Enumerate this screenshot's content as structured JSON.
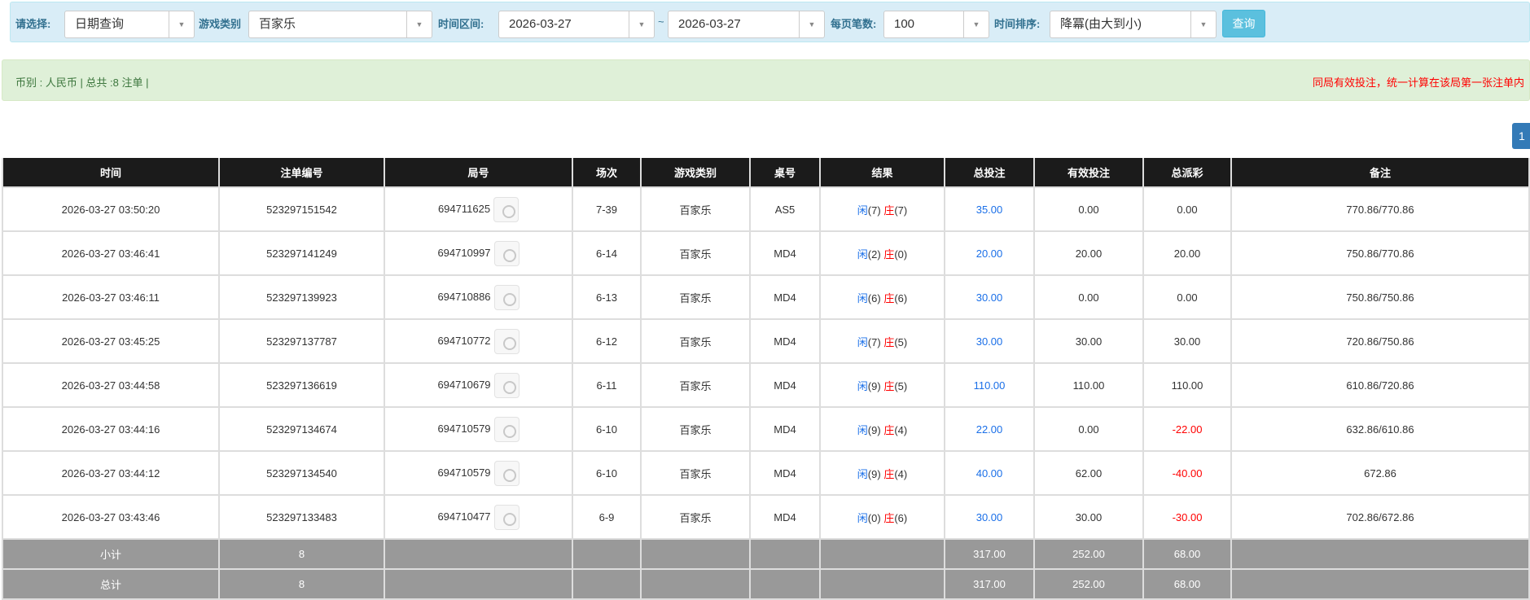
{
  "filter": {
    "select_label": "请选择:",
    "query_type": "日期查询",
    "game_label": "游戏类别",
    "game": "百家乐",
    "time_label": "时间区间:",
    "date_from": "2026-03-27",
    "tilde": "~",
    "date_to": "2026-03-27",
    "per_page_label": "每页笔数:",
    "per_page": "100",
    "sort_label": "时间排序:",
    "sort": "降冪(由大到小)",
    "search_button": "查询"
  },
  "info": {
    "summary": "币别 : 人民币 | 总共 :8 注单 |",
    "notice": "同局有效投注，统一计算在该局第一张注单内"
  },
  "pagination": {
    "current": "1"
  },
  "table": {
    "headers": [
      "时间",
      "注单编号",
      "局号",
      "场次",
      "游戏类别",
      "桌号",
      "结果",
      "总投注",
      "有效投注",
      "总派彩",
      "备注"
    ],
    "rows": [
      {
        "time": "2026-03-27 03:50:20",
        "order": "523297151542",
        "round": "694711625",
        "session": "7-39",
        "game": "百家乐",
        "table": "AS5",
        "player": "闲",
        "pv": "(7)",
        "banker": "庄",
        "bv": "(7)",
        "bet": "35.00",
        "valid": "0.00",
        "payout": "0.00",
        "payout_neg": false,
        "note": "770.86/770.86"
      },
      {
        "time": "2026-03-27 03:46:41",
        "order": "523297141249",
        "round": "694710997",
        "session": "6-14",
        "game": "百家乐",
        "table": "MD4",
        "player": "闲",
        "pv": "(2)",
        "banker": "庄",
        "bv": "(0)",
        "bet": "20.00",
        "valid": "20.00",
        "payout": "20.00",
        "payout_neg": false,
        "note": "750.86/770.86"
      },
      {
        "time": "2026-03-27 03:46:11",
        "order": "523297139923",
        "round": "694710886",
        "session": "6-13",
        "game": "百家乐",
        "table": "MD4",
        "player": "闲",
        "pv": "(6)",
        "banker": "庄",
        "bv": "(6)",
        "bet": "30.00",
        "valid": "0.00",
        "payout": "0.00",
        "payout_neg": false,
        "note": "750.86/750.86"
      },
      {
        "time": "2026-03-27 03:45:25",
        "order": "523297137787",
        "round": "694710772",
        "session": "6-12",
        "game": "百家乐",
        "table": "MD4",
        "player": "闲",
        "pv": "(7)",
        "banker": "庄",
        "bv": "(5)",
        "bet": "30.00",
        "valid": "30.00",
        "payout": "30.00",
        "payout_neg": false,
        "note": "720.86/750.86"
      },
      {
        "time": "2026-03-27 03:44:58",
        "order": "523297136619",
        "round": "694710679",
        "session": "6-11",
        "game": "百家乐",
        "table": "MD4",
        "player": "闲",
        "pv": "(9)",
        "banker": "庄",
        "bv": "(5)",
        "bet": "110.00",
        "valid": "110.00",
        "payout": "110.00",
        "payout_neg": false,
        "note": "610.86/720.86"
      },
      {
        "time": "2026-03-27 03:44:16",
        "order": "523297134674",
        "round": "694710579",
        "session": "6-10",
        "game": "百家乐",
        "table": "MD4",
        "player": "闲",
        "pv": "(9)",
        "banker": "庄",
        "bv": "(4)",
        "bet": "22.00",
        "valid": "0.00",
        "payout": "-22.00",
        "payout_neg": true,
        "note": "632.86/610.86"
      },
      {
        "time": "2026-03-27 03:44:12",
        "order": "523297134540",
        "round": "694710579",
        "session": "6-10",
        "game": "百家乐",
        "table": "MD4",
        "player": "闲",
        "pv": "(9)",
        "banker": "庄",
        "bv": "(4)",
        "bet": "40.00",
        "valid": "62.00",
        "payout": "-40.00",
        "payout_neg": true,
        "note": "672.86"
      },
      {
        "time": "2026-03-27 03:43:46",
        "order": "523297133483",
        "round": "694710477",
        "session": "6-9",
        "game": "百家乐",
        "table": "MD4",
        "player": "闲",
        "pv": "(0)",
        "banker": "庄",
        "bv": "(6)",
        "bet": "30.00",
        "valid": "30.00",
        "payout": "-30.00",
        "payout_neg": true,
        "note": "702.86/672.86"
      }
    ],
    "subtotal": {
      "label": "小计",
      "count": "8",
      "bet": "317.00",
      "valid": "252.00",
      "payout": "68.00"
    },
    "total": {
      "label": "总计",
      "count": "8",
      "bet": "317.00",
      "valid": "252.00",
      "payout": "68.00"
    }
  }
}
